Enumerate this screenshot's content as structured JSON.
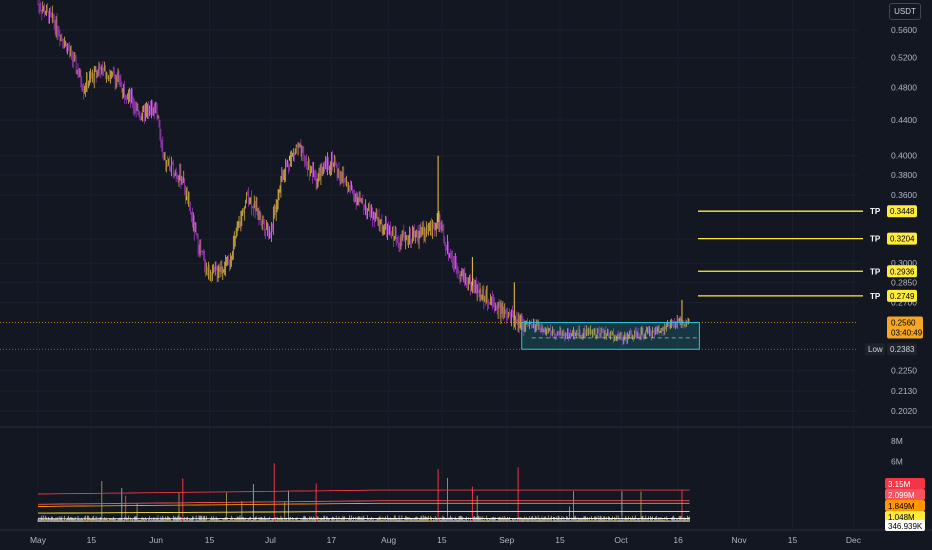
{
  "currency": "USDT",
  "chart_data": {
    "type": "candlestick-with-volume",
    "price_axis": {
      "scale": "log",
      "ticks": [
        "0.5600",
        "0.5200",
        "0.4800",
        "0.4400",
        "0.4000",
        "0.3800",
        "0.3600",
        "0.3200",
        "0.3000",
        "0.2850",
        "0.2700",
        "0.2250",
        "0.2130",
        "0.2020"
      ],
      "tick_values": [
        0.56,
        0.52,
        0.48,
        0.44,
        0.4,
        0.38,
        0.36,
        0.32,
        0.3,
        0.285,
        0.27,
        0.225,
        0.213,
        0.202
      ]
    },
    "volume_axis": {
      "ticks": [
        "8M",
        "6M"
      ],
      "tick_values": [
        8000000,
        6000000
      ]
    },
    "x_axis": {
      "labels": [
        "May",
        "15",
        "Jun",
        "15",
        "Jul",
        "17",
        "Aug",
        "15",
        "Sep",
        "15",
        "Oct",
        "16",
        "Nov",
        "15",
        "Dec"
      ]
    },
    "price_path": [
      {
        "d": "May 1",
        "p": 0.6
      },
      {
        "d": "May 5",
        "p": 0.575
      },
      {
        "d": "May 10",
        "p": 0.52
      },
      {
        "d": "May 13",
        "p": 0.48
      },
      {
        "d": "May 17",
        "p": 0.505
      },
      {
        "d": "May 22",
        "p": 0.49
      },
      {
        "d": "May 28",
        "p": 0.445
      },
      {
        "d": "Jun 1",
        "p": 0.455
      },
      {
        "d": "Jun 3",
        "p": 0.395
      },
      {
        "d": "Jun 8",
        "p": 0.375
      },
      {
        "d": "Jun 12",
        "p": 0.315
      },
      {
        "d": "Jun 15",
        "p": 0.29
      },
      {
        "d": "Jun 20",
        "p": 0.3
      },
      {
        "d": "Jun 25",
        "p": 0.36
      },
      {
        "d": "Jul 1",
        "p": 0.325
      },
      {
        "d": "Jul 4",
        "p": 0.38
      },
      {
        "d": "Jul 8",
        "p": 0.41
      },
      {
        "d": "Jul 13",
        "p": 0.375
      },
      {
        "d": "Jul 17",
        "p": 0.395
      },
      {
        "d": "Jul 22",
        "p": 0.365
      },
      {
        "d": "Jul 28",
        "p": 0.34
      },
      {
        "d": "Aug 3",
        "p": 0.32
      },
      {
        "d": "Aug 10",
        "p": 0.325
      },
      {
        "d": "Aug 14",
        "p": 0.335
      },
      {
        "d": "Aug 18",
        "p": 0.3
      },
      {
        "d": "Aug 22",
        "p": 0.285
      },
      {
        "d": "Aug 28",
        "p": 0.27
      },
      {
        "d": "Sep 1",
        "p": 0.26
      },
      {
        "d": "Sep 6",
        "p": 0.255
      },
      {
        "d": "Sep 15",
        "p": 0.248
      },
      {
        "d": "Sep 25",
        "p": 0.25
      },
      {
        "d": "Oct 1",
        "p": 0.246
      },
      {
        "d": "Oct 10",
        "p": 0.25
      },
      {
        "d": "Oct 16",
        "p": 0.256
      }
    ],
    "current_price": {
      "value": "0.2560",
      "countdown": "03:40:49"
    },
    "low": {
      "label": "Low",
      "value": "0.2383"
    },
    "take_profits": [
      {
        "label": "TP",
        "value": "0.3448"
      },
      {
        "label": "TP",
        "value": "0.3204"
      },
      {
        "label": "TP",
        "value": "0.2936"
      },
      {
        "label": "TP",
        "value": "0.2749"
      }
    ],
    "range_box": {
      "top": 0.256,
      "bottom": 0.2383,
      "from": "Sep 6",
      "to": "Oct 20"
    },
    "volume_lines": [
      {
        "value": "3.15M",
        "color": "#f23645",
        "text_color": "#ffffff"
      },
      {
        "value": "2.099M",
        "color": "#f7525f",
        "text_color": "#ffffff"
      },
      {
        "value": "1.849M",
        "color": "#ff9800",
        "text_color": "#000000"
      },
      {
        "value": "1.048M",
        "color": "#ffeb3b",
        "text_color": "#000000"
      },
      {
        "value": "346.939K",
        "color": "#ffffff",
        "text_color": "#000000"
      }
    ],
    "colors": {
      "background": "#131722",
      "candle_up": "#f5c542",
      "candle_down": "#b03bd0",
      "tp_line": "#ffeb3b",
      "range_box": "#26c6da",
      "low_tag": "#1e222d"
    }
  }
}
